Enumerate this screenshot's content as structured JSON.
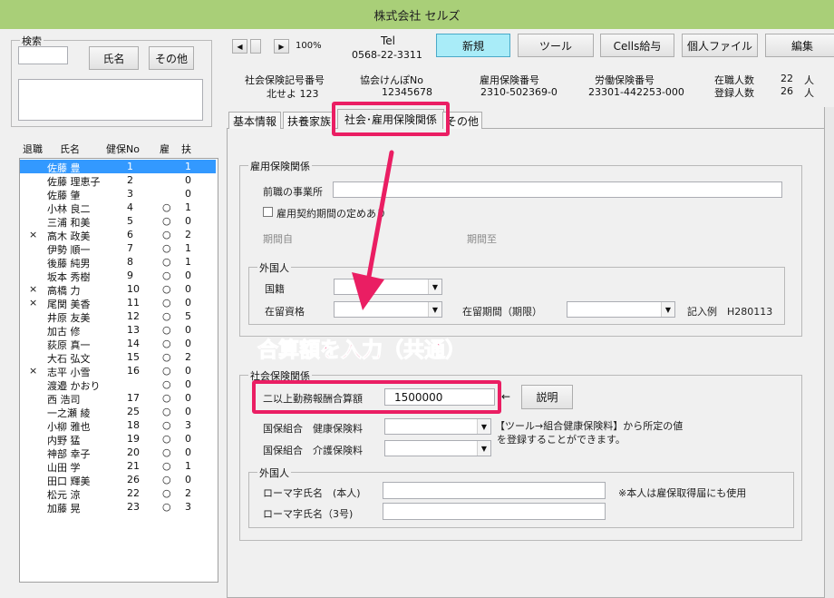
{
  "window": {
    "title": "株式会社 セルズ"
  },
  "search": {
    "label": "検索",
    "name_btn": "氏名",
    "other_btn": "その他"
  },
  "list": {
    "headers": {
      "retire": "退職",
      "name": "氏名",
      "kenpo": "健保No",
      "koyo": "雇",
      "fuyo": "扶"
    },
    "rows": [
      {
        "r": "",
        "name": "佐藤 豊",
        "no": "1",
        "k": "",
        "f": "1"
      },
      {
        "r": "",
        "name": "佐藤 理恵子",
        "no": "2",
        "k": "",
        "f": "0"
      },
      {
        "r": "",
        "name": "佐藤 肇",
        "no": "3",
        "k": "",
        "f": "0"
      },
      {
        "r": "",
        "name": "小林 良二",
        "no": "4",
        "k": "○",
        "f": "1"
      },
      {
        "r": "",
        "name": "三浦 和美",
        "no": "5",
        "k": "○",
        "f": "0"
      },
      {
        "r": "×",
        "name": "高木 政美",
        "no": "6",
        "k": "○",
        "f": "2"
      },
      {
        "r": "",
        "name": "伊勢 順一",
        "no": "7",
        "k": "○",
        "f": "1"
      },
      {
        "r": "",
        "name": "後藤 純男",
        "no": "8",
        "k": "○",
        "f": "1"
      },
      {
        "r": "",
        "name": "坂本 秀樹",
        "no": "9",
        "k": "○",
        "f": "0"
      },
      {
        "r": "×",
        "name": "高橋 力",
        "no": "10",
        "k": "○",
        "f": "0"
      },
      {
        "r": "×",
        "name": "尾関 美香",
        "no": "11",
        "k": "○",
        "f": "0"
      },
      {
        "r": "",
        "name": "井原 友美",
        "no": "12",
        "k": "○",
        "f": "5"
      },
      {
        "r": "",
        "name": "加古 修",
        "no": "13",
        "k": "○",
        "f": "0"
      },
      {
        "r": "",
        "name": "荻原 真一",
        "no": "14",
        "k": "○",
        "f": "0"
      },
      {
        "r": "",
        "name": "大石 弘文",
        "no": "15",
        "k": "○",
        "f": "2"
      },
      {
        "r": "×",
        "name": "志平 小雪",
        "no": "16",
        "k": "○",
        "f": "0"
      },
      {
        "r": "",
        "name": "渡邉 かおり",
        "no": "",
        "k": "○",
        "f": "0"
      },
      {
        "r": "",
        "name": "西 浩司",
        "no": "17",
        "k": "○",
        "f": "0"
      },
      {
        "r": "",
        "name": "一之瀬 綾",
        "no": "25",
        "k": "○",
        "f": "0"
      },
      {
        "r": "",
        "name": "小柳 雅也",
        "no": "18",
        "k": "○",
        "f": "3"
      },
      {
        "r": "",
        "name": "内野 猛",
        "no": "19",
        "k": "○",
        "f": "0"
      },
      {
        "r": "",
        "name": "神部 幸子",
        "no": "20",
        "k": "○",
        "f": "0"
      },
      {
        "r": "",
        "name": "山田 学",
        "no": "21",
        "k": "○",
        "f": "1"
      },
      {
        "r": "",
        "name": "田口 輝美",
        "no": "26",
        "k": "○",
        "f": "0"
      },
      {
        "r": "",
        "name": "松元 涼",
        "no": "22",
        "k": "○",
        "f": "2"
      },
      {
        "r": "",
        "name": "加藤 晃",
        "no": "23",
        "k": "○",
        "f": "3"
      }
    ]
  },
  "toolbar": {
    "zoom": "100%",
    "tel_label": "Tel",
    "tel": "0568-22-3311",
    "new": "新規",
    "tool": "ツール",
    "cells": "Cells給与",
    "personal": "個人ファイル",
    "edit": "編集"
  },
  "info": {
    "shaho_label": "社会保険記号番号",
    "shaho_value": "北せよ 123",
    "kyokai_label": "協会けんぽNo",
    "kyokai_value": "12345678",
    "koyo_label": "雇用保険番号",
    "koyo_value": "2310-502369-0",
    "rodo_label": "労働保険番号",
    "rodo_value": "23301-442253-000",
    "zaishoku_label": "在職人数",
    "zaishoku_value": "22",
    "zaishoku_unit": "人",
    "toroku_label": "登録人数",
    "toroku_value": "26",
    "toroku_unit": "人"
  },
  "tabs": [
    "基本情報",
    "扶養家族",
    "社会･雇用保険関係",
    "その他"
  ],
  "koyo_group": {
    "title": "雇用保険関係",
    "prev_label": "前職の事業所",
    "contract_label": "雇用契約期間の定めあり",
    "period_from": "期間自",
    "period_to": "期間至",
    "foreign_title": "外国人",
    "nationality": "国籍",
    "status": "在留資格",
    "period_limit": "在留期間（期限）",
    "example": "記入例　H280113"
  },
  "annotation": "合算額を入力（共通）",
  "shakai_group": {
    "title": "社会保険関係",
    "gassan_label": "二以上勤務報酬合算額",
    "gassan_value": "1500000",
    "arrow": "←",
    "explain": "説明",
    "kenko_label": "国保組合　健康保険料",
    "kaigo_label": "国保組合　介護保険料",
    "note1": "【ツール→組合健康保険料】から所定の値",
    "note2": "を登録することができます。",
    "foreign_title": "外国人",
    "roma1": "ローマ字氏名　(本人)",
    "roma2": "ローマ字氏名（3号)",
    "roma_note": "※本人は雇保取得届にも使用"
  },
  "colors": {
    "accent": "#ea1e63",
    "titlebar": "#a9cf78",
    "selected": "#3399ff"
  }
}
